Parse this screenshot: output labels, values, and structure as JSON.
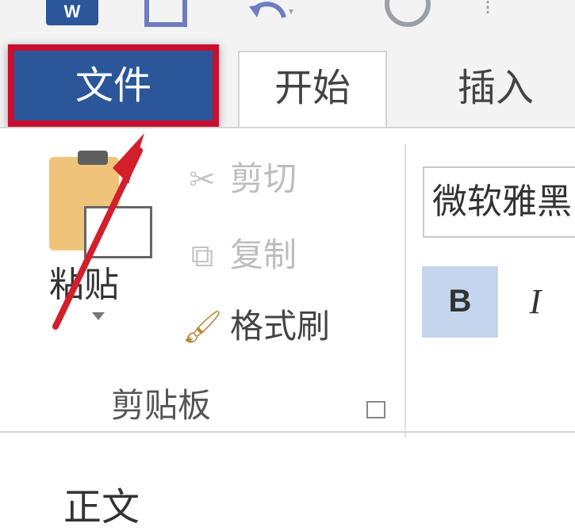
{
  "qat": {
    "word_logo": "W",
    "items": [
      "word-icon",
      "save-icon",
      "undo-icon",
      "clock-icon",
      "customize-icon"
    ]
  },
  "tabs": {
    "file": "文件",
    "home": "开始",
    "insert": "插入"
  },
  "clipboard": {
    "paste": "粘贴",
    "cut": "剪切",
    "copy": "复制",
    "format_painter": "格式刷",
    "group_label": "剪贴板"
  },
  "font": {
    "font_name": "微软雅黑",
    "bold": "B",
    "italic": "I"
  },
  "document": {
    "visible_text": "正文"
  },
  "colors": {
    "file_tab": "#2b579a",
    "highlight": "#c8102e",
    "bold_selected": "#c5d5ed"
  }
}
